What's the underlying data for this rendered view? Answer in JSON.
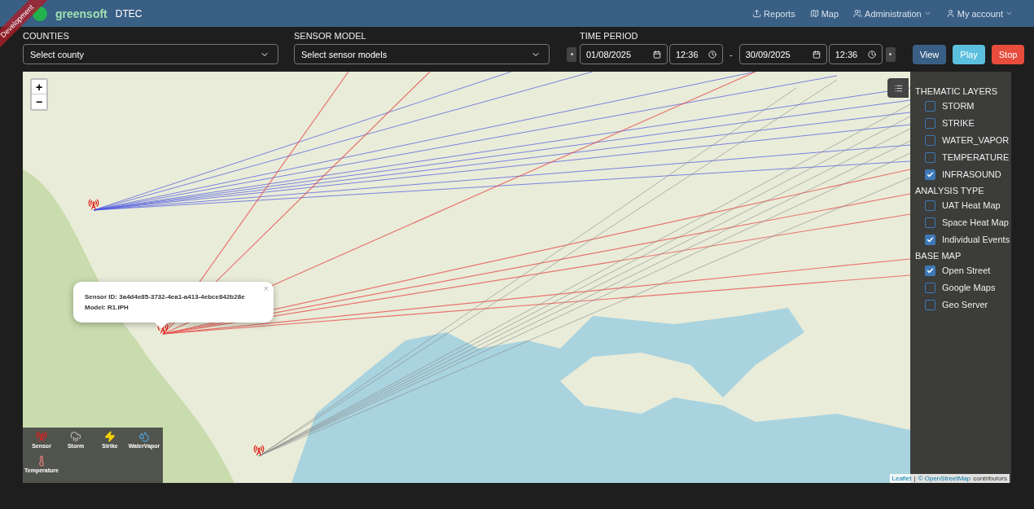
{
  "ribbon": {
    "text": "Development"
  },
  "navbar": {
    "brand": {
      "logo_text": "greensoft",
      "app_name": "DTEC"
    },
    "links": [
      {
        "label": "Reports",
        "kind": "upload",
        "dropdown": false
      },
      {
        "label": "Map",
        "kind": "map",
        "dropdown": false
      },
      {
        "label": "Administration",
        "kind": "users",
        "dropdown": true
      },
      {
        "label": "My account",
        "kind": "user",
        "dropdown": true
      }
    ]
  },
  "filters": {
    "counties": {
      "label": "COUNTIES",
      "placeholder": "Select county"
    },
    "sensor_model": {
      "label": "SENSOR MODEL",
      "placeholder": "Select sensor models"
    },
    "time_period": {
      "label": "TIME PERIOD",
      "start_date": "01/08/2025",
      "start_time": "12:36",
      "separator": "-",
      "end_date": "30/09/2025",
      "end_time": "12:36"
    },
    "buttons": [
      {
        "label": "View",
        "kind": "primary"
      },
      {
        "label": "Play",
        "kind": "info"
      },
      {
        "label": "Stop",
        "kind": "danger"
      }
    ]
  },
  "map": {
    "zoom_controls": [
      "+",
      "−"
    ],
    "popup": {
      "lines": [
        "Sensor ID: 3a4d4e85-3732-4ea1-a413-4ebce842b28e",
        "Model: R1.IPH"
      ],
      "close": "×"
    },
    "layers_panel": {
      "sections": [
        {
          "title": "THEMATIC LAYERS",
          "items": [
            {
              "label": "STORM",
              "checked": false
            },
            {
              "label": "STRIKE",
              "checked": false
            },
            {
              "label": "WATER_VAPOR",
              "checked": false
            },
            {
              "label": "TEMPERATURE",
              "checked": false
            },
            {
              "label": "INFRASOUND",
              "checked": true
            }
          ]
        },
        {
          "title": "ANALYSIS TYPE",
          "items": [
            {
              "label": "UAT Heat Map",
              "checked": false
            },
            {
              "label": "Space Heat Map",
              "checked": false
            },
            {
              "label": "Individual Events",
              "checked": true
            }
          ]
        },
        {
          "title": "BASE MAP",
          "items": [
            {
              "label": "Open Street",
              "checked": true
            },
            {
              "label": "Google Maps",
              "checked": false
            },
            {
              "label": "Geo Server",
              "checked": false
            }
          ]
        }
      ]
    },
    "legend": [
      {
        "label": "Sensor",
        "kind": "sensor"
      },
      {
        "label": "Storm",
        "kind": "storm"
      },
      {
        "label": "Strike",
        "kind": "strike"
      },
      {
        "label": "WaterVapor",
        "kind": "water_vapor"
      },
      {
        "label": "Temperature",
        "kind": "temperature"
      }
    ],
    "attribution": {
      "leaflet": "Leaflet",
      "separator": "|",
      "osm": "© OpenStreetMap",
      "suffix": "contributors"
    }
  }
}
